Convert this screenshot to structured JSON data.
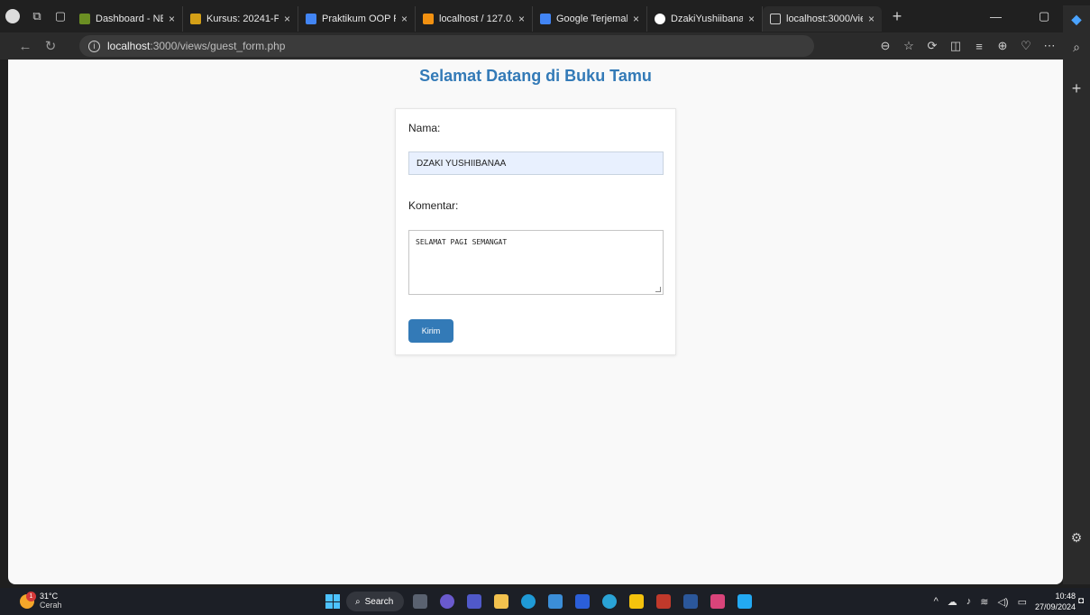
{
  "browser": {
    "tabs": [
      {
        "title": "Dashboard - NEO SI",
        "favicon_color": "#6b8e23",
        "active": false
      },
      {
        "title": "Kursus: 20241-Prak.",
        "favicon_color": "#d4a017",
        "active": false
      },
      {
        "title": "Praktikum OOP PDO",
        "favicon_color": "#4285f4",
        "active": false
      },
      {
        "title": "localhost / 127.0.0.1",
        "favicon_color": "#f29111",
        "active": false
      },
      {
        "title": "Google Terjemahan",
        "favicon_color": "#4285f4",
        "active": false
      },
      {
        "title": "DzakiYushiibanaa/P",
        "favicon_color": "#ffffff",
        "active": false
      },
      {
        "title": "localhost:3000/view",
        "favicon_color": "#cfcfcf",
        "active": true
      }
    ],
    "tab_close": "×",
    "new_tab": "+",
    "address": {
      "host": "localhost",
      "path": ":3000/views/guest_form.php"
    }
  },
  "page": {
    "title": "Selamat Datang di Buku Tamu",
    "form": {
      "name_label": "Nama:",
      "name_value": "DZAKI YUSHIIBANAA",
      "comment_label": "Komentar:",
      "comment_value": "SELAMAT PAGI SEMANGAT",
      "submit_label": "Kirim"
    }
  },
  "taskbar": {
    "weather": {
      "temp": "31°C",
      "condition": "Cerah",
      "badge": "1"
    },
    "search_label": "Search",
    "clock": {
      "time": "10:48",
      "date": "27/09/2024"
    }
  },
  "colors": {
    "accent": "#337ab7",
    "input_fill": "#e8f0fe"
  }
}
